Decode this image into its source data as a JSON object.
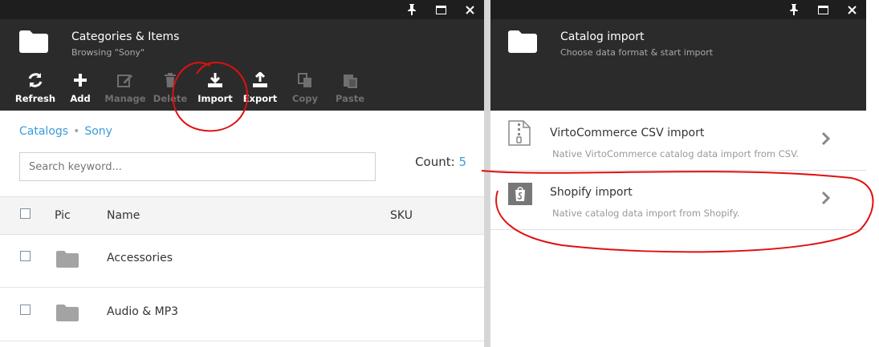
{
  "left_blade": {
    "title": "Categories & Items",
    "subtitle": "Browsing \"Sony\"",
    "toolbar": [
      {
        "label": "Refresh",
        "icon": "refresh-icon",
        "enabled": true
      },
      {
        "label": "Add",
        "icon": "plus-icon",
        "enabled": true
      },
      {
        "label": "Manage",
        "icon": "edit-icon",
        "enabled": false
      },
      {
        "label": "Delete",
        "icon": "trash-icon",
        "enabled": false
      },
      {
        "label": "Import",
        "icon": "download-icon",
        "enabled": true
      },
      {
        "label": "Export",
        "icon": "upload-icon",
        "enabled": true
      },
      {
        "label": "Copy",
        "icon": "copy-icon",
        "enabled": false
      },
      {
        "label": "Paste",
        "icon": "paste-icon",
        "enabled": false
      }
    ],
    "breadcrumbs": [
      "Catalogs",
      "Sony"
    ],
    "search": {
      "placeholder": "Search keyword...",
      "value": ""
    },
    "count_label": "Count:",
    "count_value": "5",
    "columns": [
      "Pic",
      "Name",
      "SKU"
    ],
    "rows": [
      {
        "name": "Accessories",
        "sku": ""
      },
      {
        "name": "Audio & MP3",
        "sku": ""
      }
    ]
  },
  "right_blade": {
    "title": "Catalog import",
    "subtitle": "Choose data format & start import",
    "items": [
      {
        "title": "VirtoCommerce CSV import",
        "description": "Native VirtoCommerce catalog data import from CSV.",
        "icon": "zip-file-icon"
      },
      {
        "title": "Shopify import",
        "description": "Native catalog data import from Shopify.",
        "icon": "shopify-icon"
      }
    ]
  },
  "colors": {
    "header_bg": "#2b2b2b",
    "winbar_bg": "#1e1e1e",
    "link": "#3a9bd9",
    "annotation": "#e01010"
  }
}
